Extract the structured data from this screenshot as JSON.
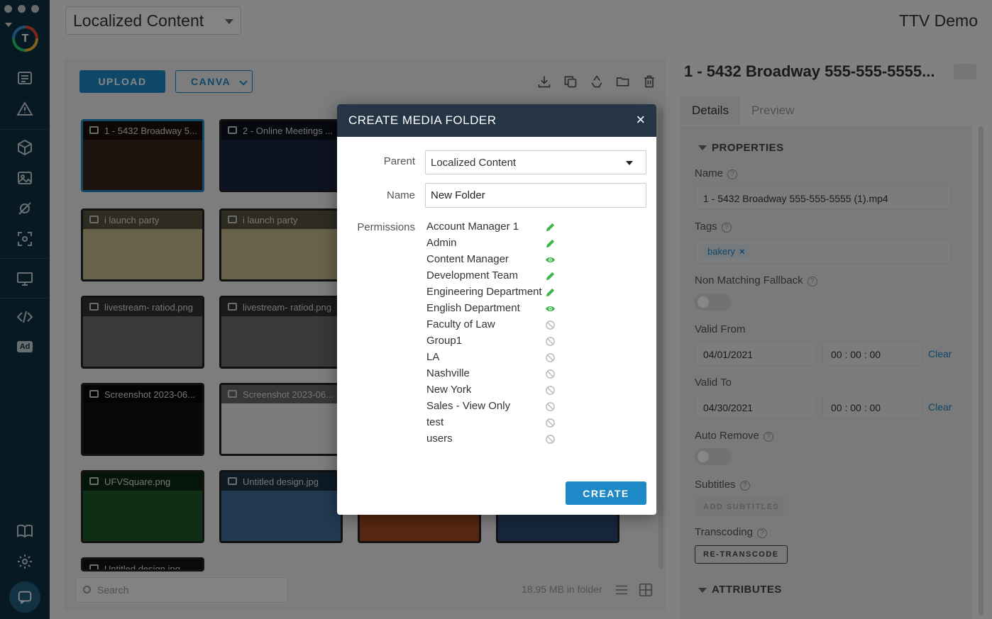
{
  "topbar": {
    "folder_select": "Localized Content",
    "app_title": "TTV Demo"
  },
  "sidebar": {
    "logo_letter": "T",
    "items": [
      "list-icon",
      "warning-icon",
      "box-icon",
      "image-icon",
      "satellite-icon",
      "screen-capture-icon",
      "monitor-icon",
      "code-icon",
      "ad-icon",
      "book-icon",
      "gear-icon",
      "chat-icon"
    ],
    "ad_label": "Ad"
  },
  "media": {
    "upload_label": "UPLOAD",
    "canva_label": "CANVA",
    "thumbnails": [
      {
        "caption": "1 - 5432 Broadway 5...",
        "color": "#3a2418"
      },
      {
        "caption": "2 - Online Meetings ...",
        "color": "#1b2540"
      },
      {
        "caption": "i launch party",
        "color": "#c2b98a"
      },
      {
        "caption": "i launch party",
        "color": "#c2b98a"
      },
      {
        "caption": "livestream- ratiod.png",
        "color": "#6d6d6d"
      },
      {
        "caption": "livestream- ratiod.png",
        "color": "#6d6d6d"
      },
      {
        "caption": "Screenshot 2023-06...",
        "color": "#121212"
      },
      {
        "caption": "Screenshot 2023-06...",
        "color": "#e9e9e9"
      },
      {
        "caption": "UFVSquare.png",
        "color": "#1c5a2a"
      },
      {
        "caption": "Untitled design.jpg",
        "color": "#3f6d99"
      },
      {
        "caption": "",
        "color": "#a64a20"
      },
      {
        "caption": "",
        "color": "#2a4a70"
      },
      {
        "caption": "Untitled design.jpg",
        "color": "#2a2a2a"
      }
    ],
    "search_placeholder": "Search",
    "folder_size": "18.95 MB in folder"
  },
  "details": {
    "title": "1 - 5432 Broadway 555-555-5555...",
    "tabs": [
      "Details",
      "Preview"
    ],
    "properties_heading": "PROPERTIES",
    "name_label": "Name",
    "name_value": "1 - 5432 Broadway 555-555-5555 (1).mp4",
    "tags_label": "Tags",
    "tag": "bakery",
    "tag_remove": "×",
    "fallback_label": "Non Matching Fallback",
    "valid_from_label": "Valid From",
    "valid_from_date": "04/01/2021",
    "valid_from_time": "00 : 00 : 00",
    "valid_to_label": "Valid To",
    "valid_to_date": "04/30/2021",
    "valid_to_time": "00 : 00 : 00",
    "clear_label": "Clear",
    "auto_remove_label": "Auto Remove",
    "subtitles_label": "Subtitles",
    "add_subtitles_label": "ADD SUBTITLES",
    "transcoding_label": "Transcoding",
    "retranscode_label": "RE-TRANSCODE",
    "attributes_heading": "ATTRIBUTES",
    "help_glyph": "?"
  },
  "modal": {
    "title": "CREATE MEDIA FOLDER",
    "close_glyph": "×",
    "parent_label": "Parent",
    "parent_value": "Localized Content",
    "name_label": "Name",
    "name_value": "New Folder",
    "permissions_label": "Permissions",
    "permissions": [
      {
        "name": "Account Manager 1",
        "level": "edit"
      },
      {
        "name": "Admin",
        "level": "edit"
      },
      {
        "name": "Content Manager",
        "level": "view"
      },
      {
        "name": "Development Team",
        "level": "edit"
      },
      {
        "name": "Engineering Department",
        "level": "edit"
      },
      {
        "name": "English Department",
        "level": "view"
      },
      {
        "name": "Faculty of Law",
        "level": "none"
      },
      {
        "name": "Group1",
        "level": "none"
      },
      {
        "name": "LA",
        "level": "none"
      },
      {
        "name": "Nashville",
        "level": "none"
      },
      {
        "name": "New York",
        "level": "none"
      },
      {
        "name": "Sales - View Only",
        "level": "none"
      },
      {
        "name": "test",
        "level": "none"
      },
      {
        "name": "users",
        "level": "none"
      }
    ],
    "create_label": "CREATE"
  },
  "colors": {
    "accent": "#1d89c7",
    "sidebar": "#0f3142",
    "modal_header": "#263545",
    "permission_green": "#3cb54a",
    "permission_none": "#bbbbbb"
  }
}
